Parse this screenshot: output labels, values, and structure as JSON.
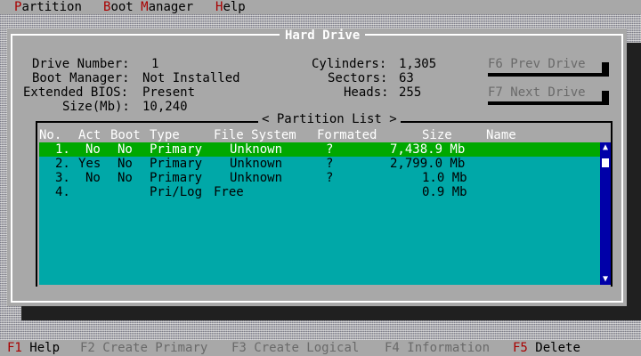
{
  "menu": {
    "items": [
      {
        "hotkey": "P",
        "rest": "artition"
      },
      {
        "hotkey": "B",
        "rest": "oot "
      },
      {
        "hotkey": "M",
        "rest": "anager"
      },
      {
        "hotkey": "H",
        "rest": "elp"
      }
    ]
  },
  "dialog": {
    "title": "Hard Drive",
    "info_left": [
      {
        "label": "Drive Number:",
        "value": "1"
      },
      {
        "label": "Boot Manager:",
        "value": "Not Installed"
      },
      {
        "label": "Extended BIOS:",
        "value": "Present"
      },
      {
        "label": "Size(Mb):",
        "value": "10,240"
      }
    ],
    "info_right": [
      {
        "label": "Cylinders:",
        "value": "1,305"
      },
      {
        "label": "Sectors:",
        "value": "63"
      },
      {
        "label": "Heads:",
        "value": "255"
      }
    ],
    "buttons": {
      "prev": "F6 Prev Drive",
      "next": "F7 Next Drive"
    }
  },
  "partition_list": {
    "title": "< Partition List >",
    "columns": [
      "No.",
      "Act",
      "Boot",
      "Type",
      "File System",
      "Formated",
      "Size",
      "Name"
    ],
    "rows": [
      {
        "no": "1.",
        "act": "No",
        "boot": "No",
        "type": "Primary",
        "fs": "Unknown",
        "formated": "?",
        "size": "7,438.9 Mb",
        "name": "",
        "selected": true
      },
      {
        "no": "2.",
        "act": "Yes",
        "boot": "No",
        "type": "Primary",
        "fs": "Unknown",
        "formated": "?",
        "size": "2,799.0 Mb",
        "name": "",
        "selected": false
      },
      {
        "no": "3.",
        "act": "No",
        "boot": "No",
        "type": "Primary",
        "fs": "Unknown",
        "formated": "?",
        "size": "1.0 Mb",
        "name": "",
        "selected": false
      },
      {
        "no": "4.",
        "act": "",
        "boot": "",
        "type": "Pri/Log",
        "fs": "Free",
        "formated": "",
        "size": "0.9 Mb",
        "name": "",
        "selected": false
      }
    ]
  },
  "statusbar": {
    "keys": [
      {
        "key": "F1",
        "label": "Help",
        "enabled": true
      },
      {
        "key": "F2",
        "label": "Create Primary",
        "enabled": false
      },
      {
        "key": "F3",
        "label": "Create Logical",
        "enabled": false
      },
      {
        "key": "F4",
        "label": "Information",
        "enabled": false
      },
      {
        "key": "F5",
        "label": "Delete",
        "enabled": true
      }
    ]
  },
  "colors": {
    "selection": "#00a800",
    "list_background": "#00a8a8",
    "hotkey": "#a80000",
    "scrollbar": "#0000a8"
  }
}
